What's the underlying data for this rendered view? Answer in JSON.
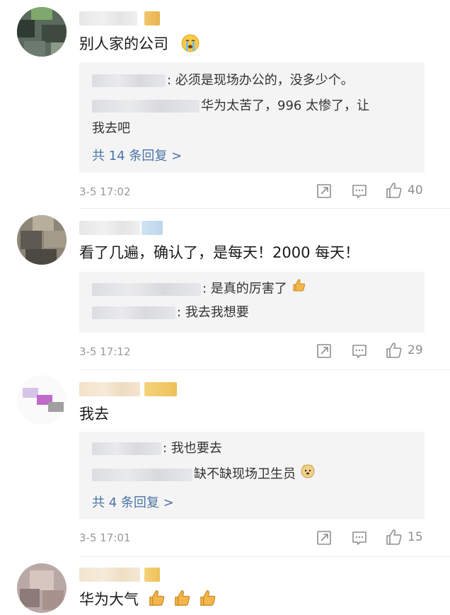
{
  "comments": [
    {
      "text": "别人家的公司",
      "replies": [
        {
          "text": ": 必须是现场办公的，没多少个。"
        },
        {
          "text": "华为太苦了，996 太惨了，让"
        },
        {
          "text": "我去吧"
        }
      ],
      "more": "共 14 条回复 >",
      "time": "3-5 17:02",
      "likes": "40"
    },
    {
      "text": "看了几遍，确认了，是每天！2000 每天！",
      "replies": [
        {
          "text": ": 是真的厉害了"
        },
        {
          "text": ": 我去我想要"
        }
      ],
      "time": "3-5 17:12",
      "likes": "29"
    },
    {
      "text": "我去",
      "replies": [
        {
          "text": ": 我也要去"
        },
        {
          "text": "缺不缺现场卫生员"
        }
      ],
      "more": "共 4 条回复 >",
      "time": "3-5 17:01",
      "likes": "15"
    },
    {
      "text": "华为大气"
    }
  ],
  "colors": {
    "link": "#4a73a5",
    "reply_bg": "#f4f4f5",
    "muted": "#9a9a9a"
  },
  "icons": [
    "share-icon",
    "comment-icon",
    "thumbs-up-icon",
    "crying-emoji",
    "thumbs-up-emoji",
    "doge-emoji"
  ]
}
